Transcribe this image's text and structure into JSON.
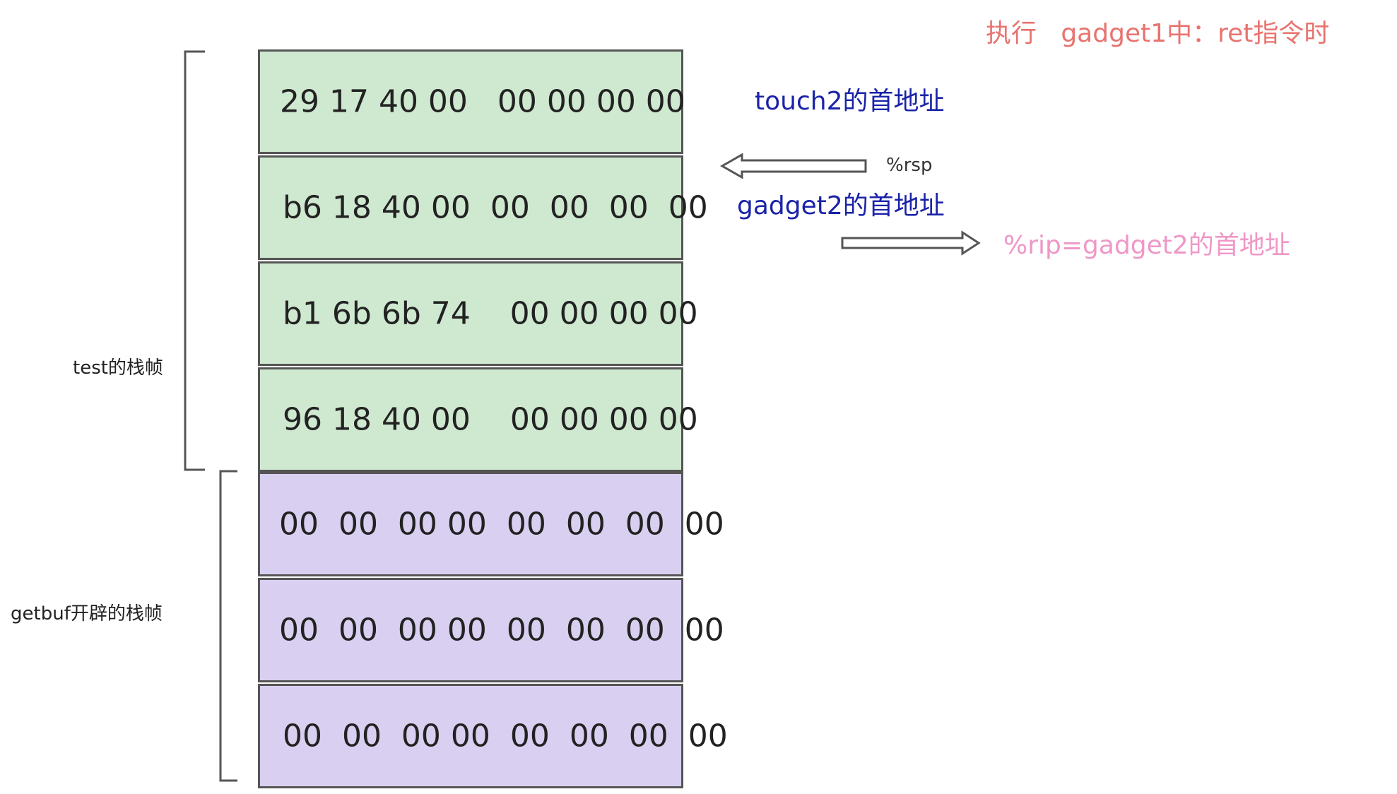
{
  "title": "执行   gadget1中：ret指令时",
  "stack_cells": [
    {
      "text": "29 17 40 00   00 00 00 00",
      "color": "green"
    },
    {
      "text": "b6 18 40 00  00  00  00  00",
      "color": "green"
    },
    {
      "text": "b1 6b 6b 74    00 00 00 00",
      "color": "green"
    },
    {
      "text": "96 18 40 00    00 00 00 00",
      "color": "green"
    },
    {
      "text": "00  00  00 00  00  00  00  00",
      "color": "purple"
    },
    {
      "text": "00  00  00 00  00  00  00  00",
      "color": "purple"
    },
    {
      "text": "00  00  00 00  00  00  00  00",
      "color": "purple"
    }
  ],
  "labels": {
    "test_frame": "test的栈帧",
    "getbuf_frame": "getbuf开辟的栈帧",
    "touch2_addr": "touch2的首地址",
    "rsp": "%rsp",
    "gadget2_addr": "gadget2的首地址",
    "rip": "%rip=gadget2的首地址"
  },
  "colors": {
    "green": "#cfe8d0",
    "purple": "#d9cff0",
    "border": "#555555",
    "title": "#e8736f",
    "blue_text": "#1a23a8",
    "pink_text": "#ef97c7"
  }
}
